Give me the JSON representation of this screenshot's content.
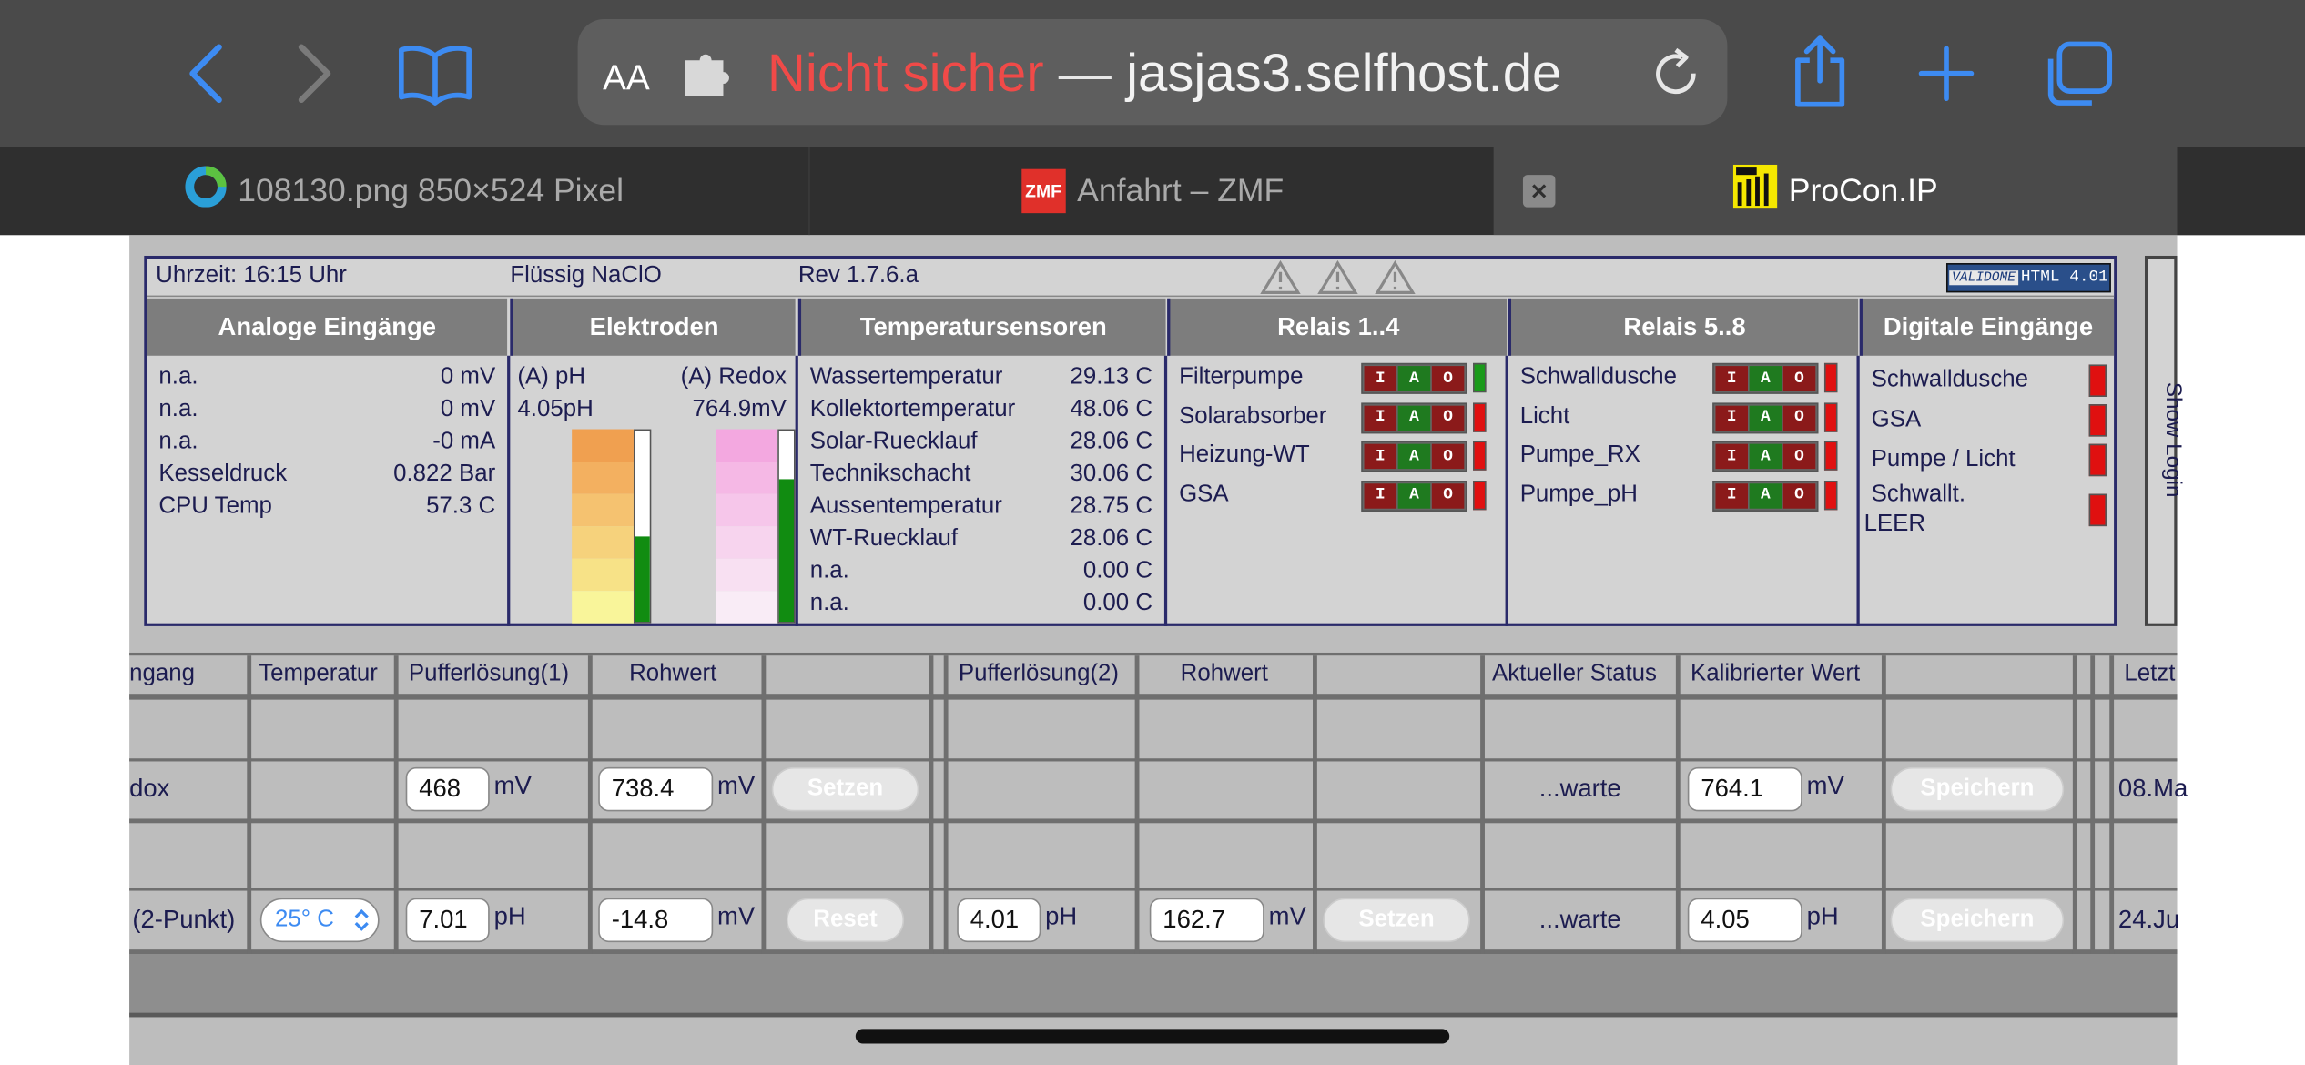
{
  "browser": {
    "reader_label": "AA",
    "url_insecure": "Nicht sicher",
    "url_dash": "—",
    "url_host": "jasjas3.selfhost.de",
    "tabs": [
      {
        "label": "108130.png 850×524 Pixel"
      },
      {
        "label": "Anfahrt – ZMF",
        "favicon_text": "ZMF"
      },
      {
        "label": "ProCon.IP",
        "active": true
      }
    ]
  },
  "status": {
    "time": "Uhrzeit: 16:15 Uhr",
    "chlorine": "Flüssig NaClO",
    "revision": "Rev 1.7.6.a",
    "validator": "HTML 4.01",
    "validator_prefix": "VALIDOME"
  },
  "headers": {
    "analog": "Analoge Eingänge",
    "electrodes": "Elektroden",
    "temperature": "Temperatursensoren",
    "relays1": "Relais 1..4",
    "relays2": "Relais 5..8",
    "digital": "Digitale Eingänge"
  },
  "analog": [
    {
      "label": "n.a.",
      "value": "0 mV"
    },
    {
      "label": "n.a.",
      "value": "0 mV"
    },
    {
      "label": "n.a.",
      "value": "-0 mA"
    },
    {
      "label": "Kesseldruck",
      "value": "0.822 Bar"
    },
    {
      "label": "CPU Temp",
      "value": "57.3 C"
    }
  ],
  "electrodes": {
    "ph_label": "(A) pH",
    "redox_label": "(A) Redox",
    "ph_value": "4.05pH",
    "redox_value": "764.9mV",
    "ph_level": 0.45,
    "redox_level": 0.75
  },
  "temperatures": [
    {
      "label": "Wassertemperatur",
      "value": "29.13 C"
    },
    {
      "label": "Kollektortemperatur",
      "value": "48.06 C"
    },
    {
      "label": "Solar-Ruecklauf",
      "value": "28.06 C"
    },
    {
      "label": "Technikschacht",
      "value": "30.06 C"
    },
    {
      "label": "Aussentemperatur",
      "value": "28.75 C"
    },
    {
      "label": "WT-Ruecklauf",
      "value": "28.06 C"
    },
    {
      "label": "n.a.",
      "value": "0.00 C"
    },
    {
      "label": "n.a.",
      "value": "0.00 C"
    }
  ],
  "relays1": [
    {
      "label": "Filterpumpe",
      "state": "on"
    },
    {
      "label": "Solarabsorber",
      "state": "off"
    },
    {
      "label": "Heizung-WT",
      "state": "off"
    },
    {
      "label": "GSA",
      "state": "off"
    }
  ],
  "relays2": [
    {
      "label": "Schwalldusche",
      "state": "off"
    },
    {
      "label": "Licht",
      "state": "off"
    },
    {
      "label": "Pumpe_RX",
      "state": "off"
    },
    {
      "label": "Pumpe_pH",
      "state": "off"
    }
  ],
  "ioa": {
    "i": "I",
    "a": "A",
    "o": "O"
  },
  "digital": [
    {
      "label": "Schwalldusche"
    },
    {
      "label": "GSA"
    },
    {
      "label": "Pumpe / Licht"
    },
    {
      "label": "Schwallt.",
      "label2": "LEER"
    }
  ],
  "show_login": "Show Login",
  "calib": {
    "headers": {
      "input": "ngang",
      "temp": "Temperatur",
      "buffer1": "Pufferlösung(1)",
      "raw1": "Rohwert",
      "buffer2": "Pufferlösung(2)",
      "raw2": "Rohwert",
      "status": "Aktueller Status",
      "calibrated": "Kalibrierter Wert",
      "last": "Letzt"
    },
    "redox": {
      "name": "dox",
      "buffer1": "468",
      "buffer1_unit": "mV",
      "raw1": "738.4",
      "raw1_unit": "mV",
      "set_button": "Setzen",
      "status": "...warte",
      "calibrated": "764.1",
      "calibrated_unit": "mV",
      "save_button": "Speichern",
      "last": "08.Ma"
    },
    "ph": {
      "name": "(2-Punkt)",
      "temp_select": "25° C",
      "buffer1": "7.01",
      "buffer1_unit": "pH",
      "raw1": "-14.8",
      "raw1_unit": "mV",
      "reset_button": "Reset",
      "buffer2": "4.01",
      "buffer2_unit": "pH",
      "raw2": "162.7",
      "raw2_unit": "mV",
      "set_button": "Setzen",
      "status": "...warte",
      "calibrated": "4.05",
      "calibrated_unit": "pH",
      "save_button": "Speichern",
      "last": "24.Ju"
    }
  },
  "colors": {
    "toolbar": "#4a4a4a",
    "accent": "#3d8bf2",
    "insecure": "#f04a48",
    "relay_on": "#1a9a1a",
    "relay_off": "#e01010",
    "io_red": "#8b1a1a",
    "io_green": "#1f7a1f"
  }
}
